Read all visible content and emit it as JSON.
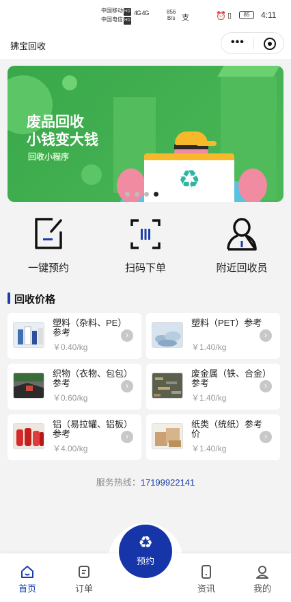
{
  "status_bar": {
    "carrier1": "中国移动",
    "carrier2": "中国电信",
    "hd": "HD",
    "signal": "4G 4G",
    "speed_value": "856",
    "speed_unit": "B/s",
    "battery": "85",
    "time": "4:11"
  },
  "navbar": {
    "title": "狒宝回收",
    "more_label": "•••"
  },
  "banner": {
    "title_line1": "废品回收",
    "title_line2": "小钱变大钱",
    "subtitle": "回收小程序",
    "slide_count": 4,
    "active_slide": 4
  },
  "quick_actions": [
    {
      "label": "一键预约",
      "icon": "edit-square-icon"
    },
    {
      "label": "扫码下单",
      "icon": "scan-icon"
    },
    {
      "label": "附近回收员",
      "icon": "person-icon"
    }
  ],
  "price_section": {
    "title": "回收价格",
    "items": [
      {
        "name": "塑料（杂料、PE）参考",
        "price": "￥0.40/kg",
        "thumb": "plastic-bottles"
      },
      {
        "name": "塑料（PET）参考",
        "price": "￥1.40/kg",
        "thumb": "pet-bottles"
      },
      {
        "name": "织物（衣物、包包）参考",
        "price": "￥0.60/kg",
        "thumb": "clothes"
      },
      {
        "name": "废金属（铁、合金）参考",
        "price": "￥1.40/kg",
        "thumb": "scrap-metal"
      },
      {
        "name": "铝（易拉罐、铝板）参考",
        "price": "￥4.00/kg",
        "thumb": "cans"
      },
      {
        "name": "纸类（统纸）参考价",
        "price": "￥1.40/kg",
        "thumb": "cardboard"
      }
    ]
  },
  "hotline": {
    "label": "服务热线：",
    "number": "17199922141"
  },
  "tabbar": {
    "home": "首页",
    "orders": "订单",
    "reserve": "预约",
    "news": "资讯",
    "mine": "我的"
  },
  "colors": {
    "primary": "#1535a8",
    "banner_green": "#38a84a",
    "arrow_gray": "#c8c8c8"
  }
}
